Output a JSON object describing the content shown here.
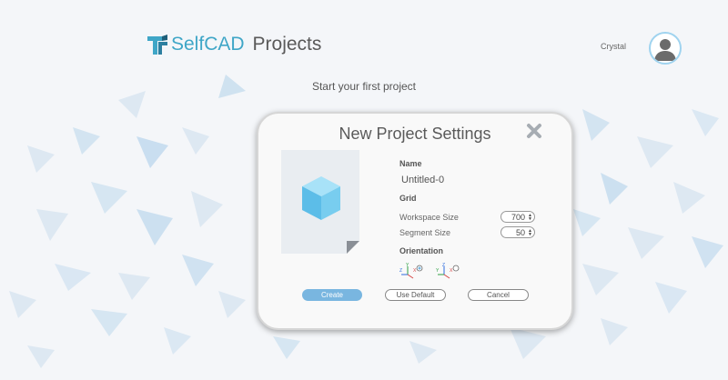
{
  "header": {
    "logo_self": "Self",
    "logo_cad": "CAD",
    "logo_projects": "Projects",
    "username": "Crystal"
  },
  "main": {
    "start_text": "Start your first project"
  },
  "dialog": {
    "title": "New Project Settings",
    "name_label": "Name",
    "name_value": "Untitled-0",
    "grid_label": "Grid",
    "workspace_label": "Workspace Size",
    "workspace_value": "700",
    "segment_label": "Segment Size",
    "segment_value": "50",
    "orientation_label": "Orientation",
    "orientation_options": [
      {
        "axes": [
          "Z",
          "Y",
          "X"
        ],
        "selected": true
      },
      {
        "axes": [
          "Y",
          "Z",
          "X"
        ],
        "selected": false
      }
    ],
    "create_label": "Create",
    "use_default_label": "Use Default",
    "cancel_label": "Cancel"
  },
  "colors": {
    "accent": "#3fa6c7",
    "create_button": "#79b6e0",
    "background": "#f4f6f9"
  },
  "icons": {
    "logo": "selfcad-logo-icon",
    "avatar": "user-avatar-icon",
    "close": "close-icon",
    "preview": "cube-icon"
  }
}
